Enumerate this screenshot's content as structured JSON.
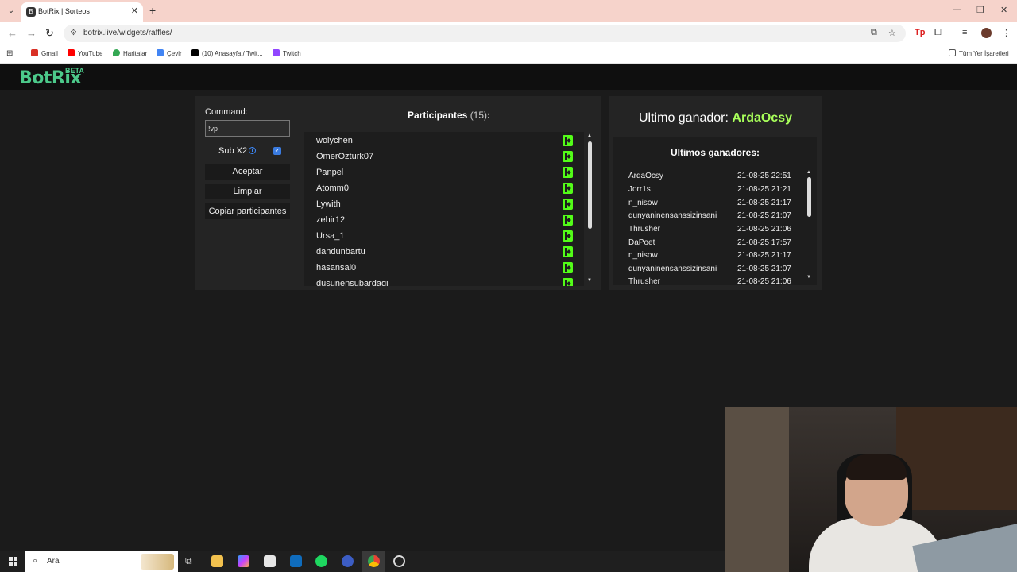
{
  "browser": {
    "tab_title": "BotRix | Sorteos",
    "tab_close": "✕",
    "new_tab": "+",
    "url": "botrix.live/widgets/raffles/",
    "bookmarks": [
      {
        "label": "Gmail",
        "color": "#d93025"
      },
      {
        "label": "YouTube",
        "color": "#ff0000"
      },
      {
        "label": "Haritalar",
        "color": "#34a853"
      },
      {
        "label": "Çevir",
        "color": "#4285f4"
      },
      {
        "label": "(10) Anasayfa / Twit...",
        "color": "#000000"
      },
      {
        "label": "Twitch",
        "color": "#9146ff"
      }
    ],
    "all_bookmarks": "Tüm Yer İşaretleri"
  },
  "brand": {
    "name": "BotRix",
    "beta": "BETA",
    "color": "#4cc98a"
  },
  "controls": {
    "command_label": "Command:",
    "command_value": "!vp",
    "sub_label": "Sub X2",
    "sub_checked": true,
    "accept_label": "Aceptar",
    "clear_label": "Limpiar",
    "copy_label": "Copiar participantes"
  },
  "participants": {
    "title": "Participantes",
    "count": "(15)",
    "suffix": ":",
    "items": [
      "wolychen",
      "OmerOzturk07",
      "Panpel",
      "Atomm0",
      "Lywith",
      "zehir12",
      "Ursa_1",
      "dandunbartu",
      "hasansal0",
      "dusunensubardagi"
    ]
  },
  "winner": {
    "label": "Ultimo ganador:",
    "name": "ArdaOcsy",
    "highlight_color": "#a8ff5a"
  },
  "winners": {
    "title": "Ultimos ganadores:",
    "rows": [
      {
        "name": "ArdaOcsy",
        "date": "21-08-25 22:51"
      },
      {
        "name": "Jorr1s",
        "date": "21-08-25 21:21"
      },
      {
        "name": "n_nisow",
        "date": "21-08-25 21:17"
      },
      {
        "name": "dunyaninensanssizinsani",
        "date": "21-08-25 21:07"
      },
      {
        "name": "Thrusher",
        "date": "21-08-25 21:06"
      },
      {
        "name": "DaPoet",
        "date": "21-08-25 17:57"
      },
      {
        "name": "n_nisow",
        "date": "21-08-25 21:17"
      },
      {
        "name": "dunyaninensanssizinsani",
        "date": "21-08-25 21:07"
      },
      {
        "name": "Thrusher",
        "date": "21-08-25 21:06"
      }
    ]
  },
  "taskbar": {
    "search_placeholder": "Ara"
  }
}
